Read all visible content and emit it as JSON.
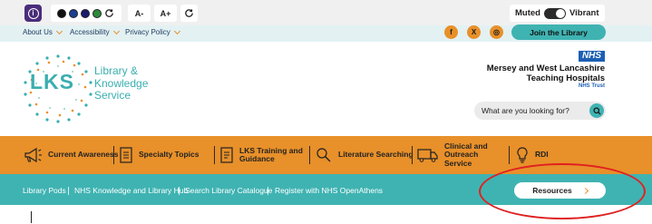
{
  "toolbar": {
    "accessibility_icon": "accessibility-icon",
    "contrast_colors": [
      "#111111",
      "#1d3f8f",
      "#1a1a6e",
      "#2a8a3a"
    ],
    "reset_icon": "reload-icon",
    "text_smaller": "A-",
    "text_larger": "A+",
    "mode_left": "Muted",
    "mode_right": "Vibrant"
  },
  "top_nav": {
    "items": [
      "About Us",
      "Accessibility",
      "Privacy Policy"
    ],
    "social": [
      {
        "name": "facebook",
        "glyph": "f"
      },
      {
        "name": "x",
        "glyph": "X"
      },
      {
        "name": "instagram",
        "glyph": "◎"
      }
    ],
    "join_label": "Join the Library"
  },
  "header": {
    "logo_abbr": "LKS",
    "logo_name_lines": [
      "Library &",
      "Knowledge",
      "Service"
    ],
    "nhs_badge": "NHS",
    "trust_lines": [
      "Mersey and West Lancashire",
      "Teaching Hospitals"
    ],
    "trust_sub": "NHS Trust",
    "search_placeholder": "What are you looking for?"
  },
  "main_menu": [
    {
      "label": "Current Awareness",
      "icon": "megaphone-icon"
    },
    {
      "label": "Specialty Topics",
      "icon": "document-icon"
    },
    {
      "label": "LKS Training and Guidance",
      "icon": "document-icon"
    },
    {
      "label": "Literature Searching",
      "icon": "search-person-icon"
    },
    {
      "label": "Clinical and Outreach Service",
      "icon": "truck-icon"
    },
    {
      "label": "RDI",
      "icon": "lightbulb-icon"
    }
  ],
  "sub_nav": {
    "items": [
      "Library Pods",
      "NHS Knowledge and Library Hub",
      "Search Library Catalogue",
      "Register with NHS OpenAthens"
    ],
    "resources_label": "Resources"
  },
  "colors": {
    "orange": "#e8902a",
    "teal": "#3fb3b2",
    "purple": "#4a2d7a",
    "nhs_blue": "#1d5fb3",
    "highlight_red": "#e02020"
  }
}
